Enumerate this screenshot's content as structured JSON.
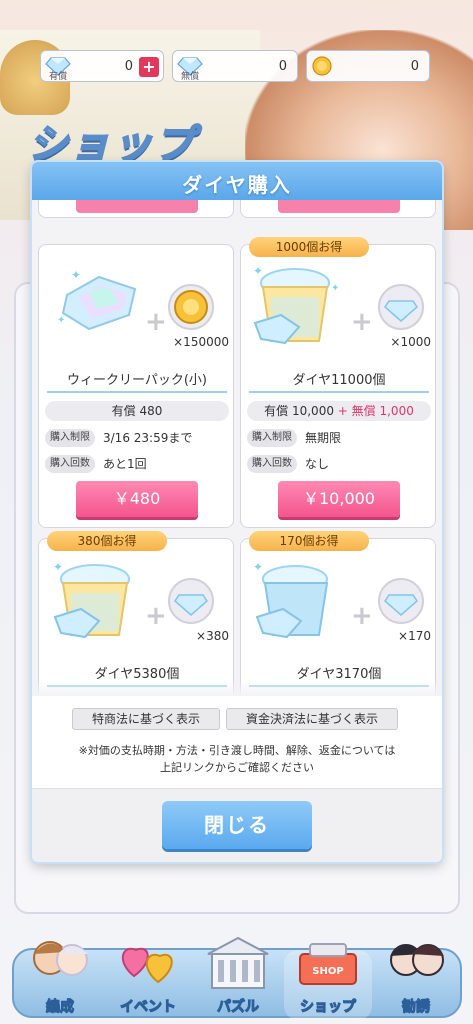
{
  "currency": [
    {
      "label": "有償",
      "value": "0",
      "plus": "+"
    },
    {
      "label": "無償",
      "value": "0"
    },
    {
      "label": "",
      "value": "0"
    }
  ],
  "shop_title": "ショップ",
  "modal": {
    "title": "ダイヤ購入",
    "cards": [
      {
        "ribbon": "",
        "bonus_qty": "×150000",
        "name": "ウィークリーパック(小)",
        "paid": "有償 480",
        "free": "",
        "limit_label": "購入制限",
        "limit_value": "3/16 23:59まで",
        "count_label": "購入回数",
        "count_value": "あと1回",
        "price": "￥480"
      },
      {
        "ribbon": "1000個お得",
        "bonus_qty": "×1000",
        "name": "ダイヤ11000個",
        "paid": "有償 10,000",
        "free": "+ 無償 1,000",
        "limit_label": "購入制限",
        "limit_value": "無期限",
        "count_label": "購入回数",
        "count_value": "なし",
        "price": "￥10,000"
      },
      {
        "ribbon": "380個お得",
        "bonus_qty": "×380",
        "name": "ダイヤ5380個"
      },
      {
        "ribbon": "170個お得",
        "bonus_qty": "×170",
        "name": "ダイヤ3170個"
      }
    ],
    "legal_buttons": [
      "特商法に基づく表示",
      "資金決済法に基づく表示"
    ],
    "note_line1": "※対価の支払時期・方法・引き渡し時間、解除、返金については",
    "note_line2": "上記リンクからご確認ください",
    "close_label": "閉じる"
  },
  "nav": [
    {
      "label": "編成"
    },
    {
      "label": "イベント"
    },
    {
      "label": "パズル"
    },
    {
      "label": "ショップ",
      "active": true
    },
    {
      "label": "勧誘"
    }
  ],
  "colors": {
    "header_blue": "#5aa7ea",
    "buy_pink": "#f4558d",
    "free_pink": "#e0356a",
    "ribbon_gold": "#f6b24b"
  }
}
